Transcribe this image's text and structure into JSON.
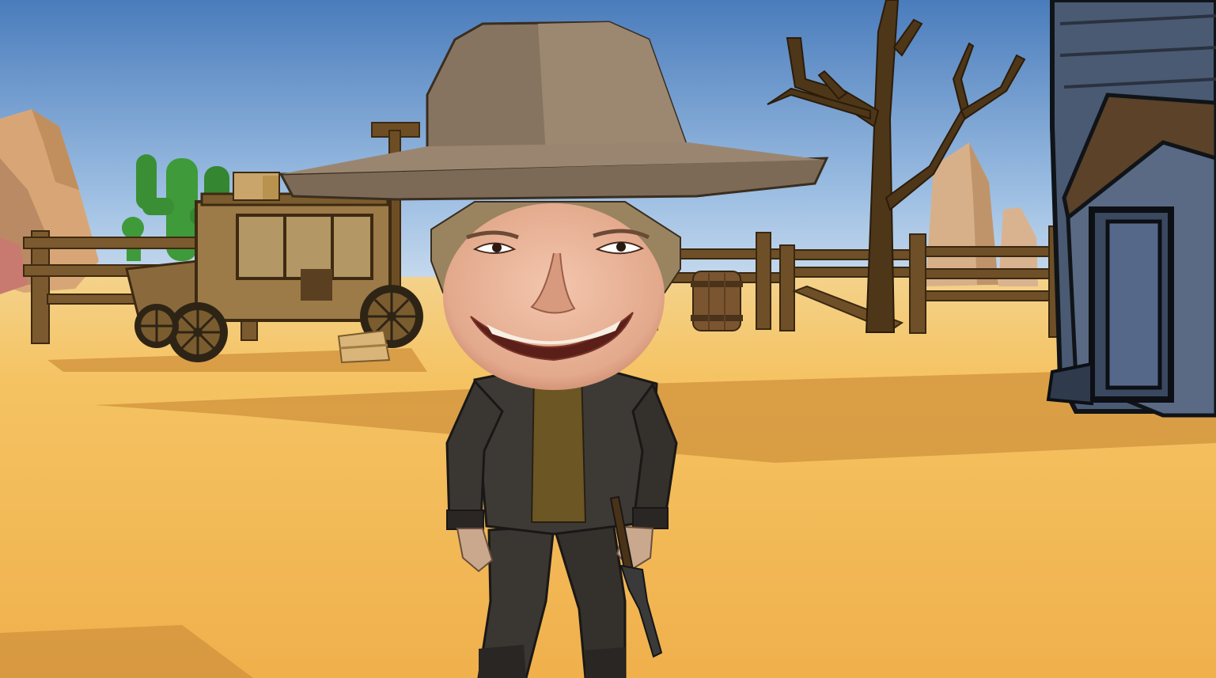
{
  "scene": {
    "title": "",
    "palette": {
      "sky_top": "#4f80bf",
      "sky_bottom": "#b9d2ea",
      "sand": "#f2b955",
      "sand_light": "#f7c86a",
      "shadow": "#c98a36",
      "wood": "#7a5a2e",
      "wood_dark": "#4e3618",
      "hat": "#877460",
      "jacket": "#3d3a36",
      "shirt": "#6b5624",
      "skin": "#e9b699",
      "cactus": "#3f9a3a",
      "building": "#3a4355",
      "rock": "#d9a878"
    },
    "objects": [
      {
        "name": "stagecoach"
      },
      {
        "name": "cactus"
      },
      {
        "name": "fence"
      },
      {
        "name": "barrel"
      },
      {
        "name": "dead-tree"
      },
      {
        "name": "wooden-building"
      },
      {
        "name": "cowboy-character"
      }
    ]
  }
}
